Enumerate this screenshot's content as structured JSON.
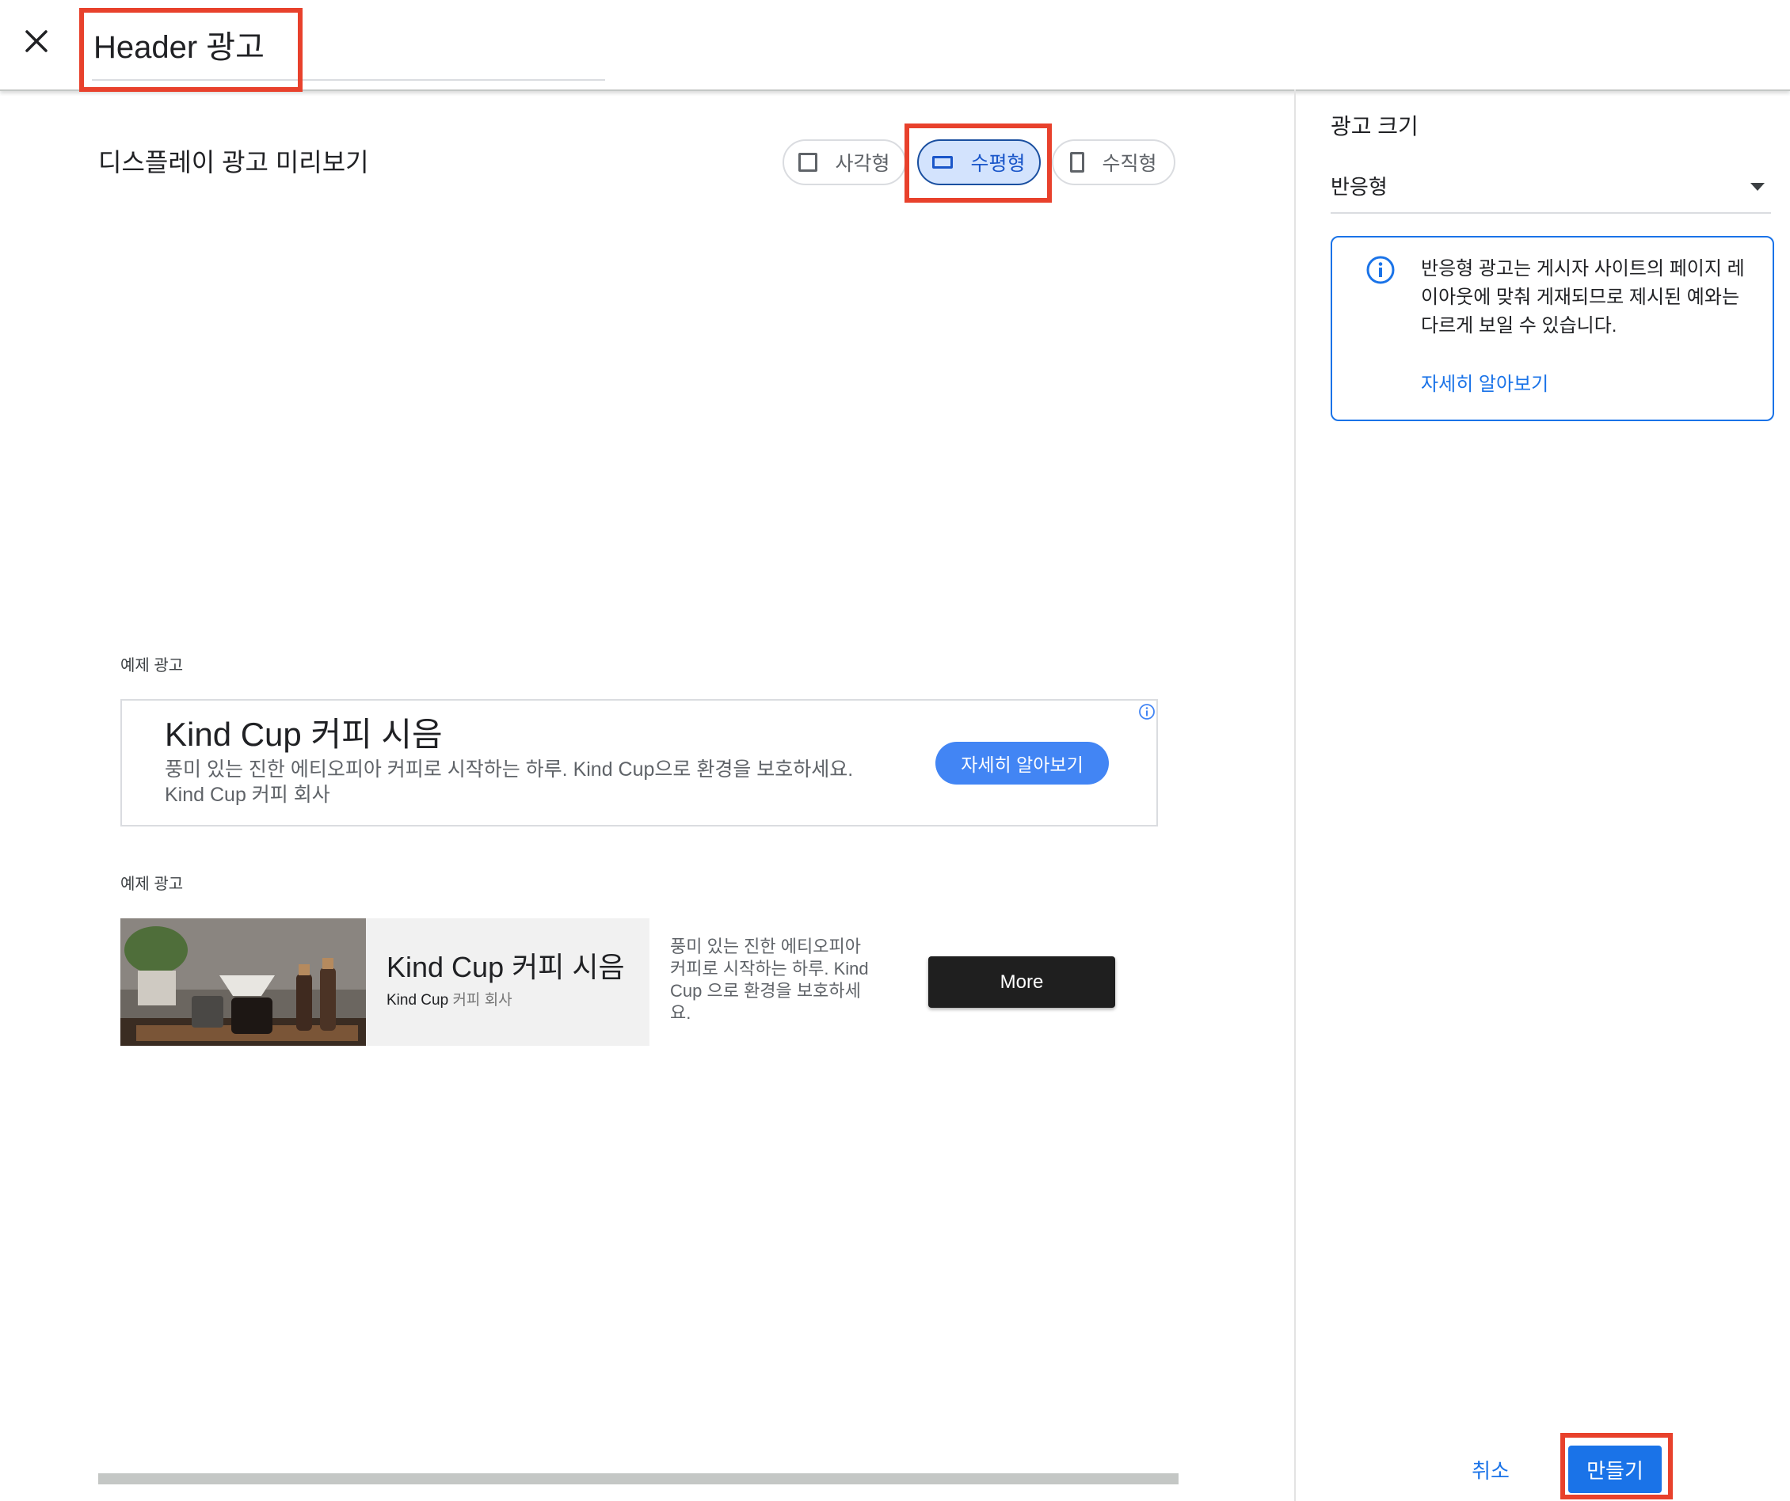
{
  "header": {
    "close_icon": "close-icon",
    "title": "Header 광고"
  },
  "preview": {
    "title": "디스플레이 광고 미리보기",
    "shapes": [
      {
        "label": "사각형",
        "icon": "square-icon",
        "selected": false
      },
      {
        "label": "수평형",
        "icon": "horizontal-rectangle-icon",
        "selected": true
      },
      {
        "label": "수직형",
        "icon": "vertical-rectangle-icon",
        "selected": false
      }
    ]
  },
  "sample_ads": [
    {
      "label": "예제 광고",
      "headline": "Kind Cup 커피 시음",
      "description": "풍미 있는 진한 에티오피아 커피로 시작하는 하루. Kind Cup으로 환경을 보호하세요. Kind Cup 커피 회사",
      "cta": "자세히 알아보기",
      "info_icon": "ad-info-icon"
    },
    {
      "label": "예제 광고",
      "headline": "Kind Cup 커피 시음",
      "advertiser_brand": "Kind Cup",
      "advertiser_rest": " 커피 회사",
      "description": "풍미 있는 진한 에티오피아 커피로 시작하는 하루. Kind Cup 으로 환경을 보호하세요.",
      "cta": "More",
      "image": "coffee-pour-over-photo"
    }
  ],
  "sidebar": {
    "size_title": "광고 크기",
    "size_value": "반응형",
    "info_text": "반응형 광고는 게시자 사이트의 페이지 레이아웃에 맞춰 게재되므로 제시된 예와는 다르게 보일 수 있습니다.",
    "info_link": "자세히 알아보기",
    "cancel": "취소",
    "create": "만들기"
  },
  "colors": {
    "accent": "#1a73e8",
    "highlight": "#e8412c",
    "selected_chip": "#d3e3fd",
    "cta_blue": "#4285f4",
    "cta_dark": "#1f1f1f"
  }
}
